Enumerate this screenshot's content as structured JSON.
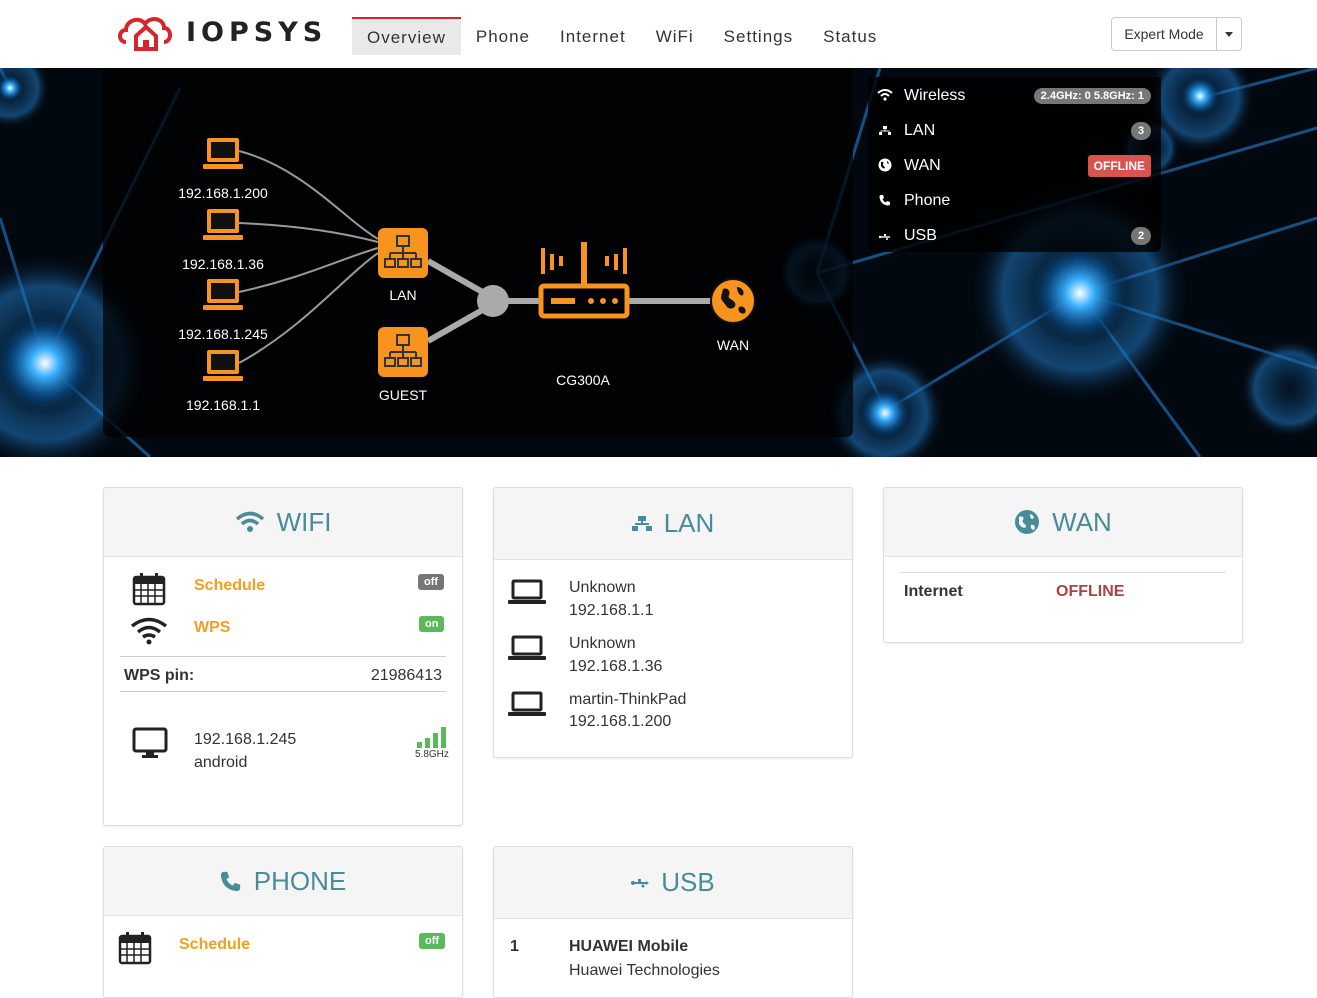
{
  "header": {
    "logo": "IOPSYS",
    "nav": [
      "Overview",
      "Phone",
      "Internet",
      "WiFi",
      "Settings",
      "Status"
    ],
    "active_tab": "Overview",
    "expert_mode": "Expert Mode"
  },
  "topology": {
    "clients": [
      "192.168.1.200",
      "192.168.1.36",
      "192.168.1.245",
      "192.168.1.1"
    ],
    "lan_label": "LAN",
    "guest_label": "GUEST",
    "router_label": "CG300A",
    "wan_label": "WAN"
  },
  "summary": {
    "wireless": {
      "label": "Wireless",
      "badge": "2.4GHz: 0 5.8GHz: 1"
    },
    "lan": {
      "label": "LAN",
      "badge": "3"
    },
    "wan": {
      "label": "WAN",
      "badge": "OFFLINE"
    },
    "phone": {
      "label": "Phone"
    },
    "usb": {
      "label": "USB",
      "badge": "2"
    }
  },
  "wifi_panel": {
    "title": "WIFI",
    "schedule_label": "Schedule",
    "schedule_state": "off",
    "wps_label": "WPS",
    "wps_state": "on",
    "wps_pin_label": "WPS pin:",
    "wps_pin_value": "21986413",
    "client_ip": "192.168.1.245",
    "client_name": "android",
    "client_band": "5.8GHz",
    "client_signal_bars": 4
  },
  "lan_panel": {
    "title": "LAN",
    "devices": [
      {
        "name": "Unknown",
        "ip": "192.168.1.1"
      },
      {
        "name": "Unknown",
        "ip": "192.168.1.36"
      },
      {
        "name": "martin-ThinkPad",
        "ip": "192.168.1.200"
      }
    ]
  },
  "wan_panel": {
    "title": "WAN",
    "internet_label": "Internet",
    "internet_status": "OFFLINE"
  },
  "phone_panel": {
    "title": "PHONE",
    "schedule_label": "Schedule",
    "schedule_state": "off"
  },
  "usb_panel": {
    "title": "USB",
    "index": "1",
    "device_name": "HUAWEI Mobile",
    "device_vendor": "Huawei Technologies"
  },
  "colors": {
    "accent_orange": "#f7931e",
    "panel_title": "#4a8b99",
    "offline_red": "#d9534f",
    "on_green": "#5cb85c",
    "nav_active_border": "#d9242b"
  }
}
